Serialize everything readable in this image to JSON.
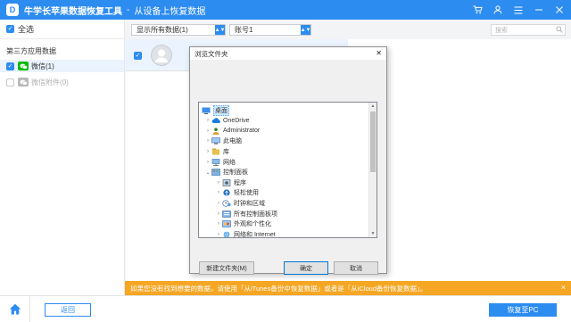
{
  "app": {
    "title": "牛学长苹果数据恢复工具",
    "separator": "-",
    "subtitle": "从设备上恢复数据",
    "logo_letter": "D"
  },
  "window_controls": [
    "cart-icon",
    "user-icon",
    "menu-icon",
    "minimize-icon",
    "close-icon"
  ],
  "left_panel": {
    "select_all": "全选",
    "section_title": "第三方应用数据",
    "items": [
      {
        "label": "微信(1)",
        "checked": true,
        "enabled": true
      },
      {
        "label": "微信附件(0)",
        "checked": false,
        "enabled": false
      }
    ]
  },
  "toolbar": {
    "filter_value": "显示所有数据(1)",
    "account_value": "账号1",
    "search_placeholder": "搜索"
  },
  "contact": {
    "name": ""
  },
  "notice": {
    "text": "如果您没有找到想要的数据，请使用「从iTunes备份中恢复数据」或者是「从iCloud备份恢复数据」。",
    "close": "×"
  },
  "bottom": {
    "back_label": "返回",
    "recover_label": "恢复至PC"
  },
  "dialog": {
    "title": "浏览文件夹",
    "close": "✕",
    "tree": [
      {
        "label": "桌面",
        "indent": 0,
        "chevron": "",
        "icon": "desktop-icon",
        "selected": true
      },
      {
        "label": "OneDrive",
        "indent": 1,
        "chevron": "›",
        "icon": "cloud-icon",
        "selected": false
      },
      {
        "label": "Administrator",
        "indent": 1,
        "chevron": "›",
        "icon": "user-folder-icon",
        "selected": false
      },
      {
        "label": "此电脑",
        "indent": 1,
        "chevron": "›",
        "icon": "computer-icon",
        "selected": false
      },
      {
        "label": "库",
        "indent": 1,
        "chevron": "›",
        "icon": "library-icon",
        "selected": false
      },
      {
        "label": "网络",
        "indent": 1,
        "chevron": "›",
        "icon": "network-icon",
        "selected": false
      },
      {
        "label": "控制面板",
        "indent": 1,
        "chevron": "⌄",
        "icon": "control-panel-icon",
        "selected": false
      },
      {
        "label": "程序",
        "indent": 2,
        "chevron": "›",
        "icon": "programs-icon",
        "selected": false
      },
      {
        "label": "轻松使用",
        "indent": 2,
        "chevron": "›",
        "icon": "ease-of-access-icon",
        "selected": false
      },
      {
        "label": "时钟和区域",
        "indent": 2,
        "chevron": "›",
        "icon": "clock-region-icon",
        "selected": false
      },
      {
        "label": "所有控制面板项",
        "indent": 2,
        "chevron": "›",
        "icon": "all-items-icon",
        "selected": false
      },
      {
        "label": "外观和个性化",
        "indent": 2,
        "chevron": "›",
        "icon": "appearance-icon",
        "selected": false
      },
      {
        "label": "网络和 Internet",
        "indent": 2,
        "chevron": "›",
        "icon": "network-internet-icon",
        "selected": false
      }
    ],
    "buttons": {
      "new_folder": "新建文件夹(M)",
      "ok": "确定",
      "cancel": "取消"
    }
  },
  "colors": {
    "primary": "#2d8cf0",
    "notice": "#f5a623",
    "wechat": "#09bb07"
  }
}
